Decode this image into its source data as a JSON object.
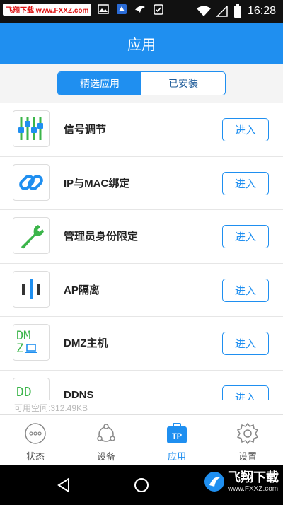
{
  "status_bar": {
    "watermark": "飞翔下载 www.FXXZ.com",
    "time": "16:28",
    "left_icons": [
      "image-icon",
      "app-icon",
      "bird-icon",
      "clipboard-check-icon"
    ],
    "right_icons": [
      "wifi-icon",
      "signal-icon",
      "battery-icon"
    ]
  },
  "header": {
    "title": "应用"
  },
  "tabs": [
    {
      "label": "精选应用",
      "active": true
    },
    {
      "label": "已安装",
      "active": false
    }
  ],
  "apps": [
    {
      "name": "信号调节",
      "button": "进入",
      "icon": "equalizer-icon"
    },
    {
      "name": "IP与MAC绑定",
      "button": "进入",
      "icon": "link-icon"
    },
    {
      "name": "管理员身份限定",
      "button": "进入",
      "icon": "wrench-icon"
    },
    {
      "name": "AP隔离",
      "button": "进入",
      "icon": "isolation-icon"
    },
    {
      "name": "DMZ主机",
      "button": "进入",
      "icon": "dmz-icon",
      "icon_text_1": "DM",
      "icon_text_2": "Z"
    },
    {
      "name": "DDNS",
      "button": "进入",
      "icon": "ddns-icon",
      "icon_text_1": "DD"
    }
  ],
  "free_space": "可用空间:312.49KB",
  "bottom_tabs": [
    {
      "label": "状态",
      "icon": "status-icon",
      "active": false
    },
    {
      "label": "设备",
      "icon": "devices-icon",
      "active": false
    },
    {
      "label": "应用",
      "icon": "tp-apps-icon",
      "active": true,
      "badge": "TP"
    },
    {
      "label": "设置",
      "icon": "gear-icon",
      "active": false
    }
  ],
  "watermark": {
    "brand": "飞翔下载",
    "url": "www.FXXZ.com"
  },
  "colors": {
    "accent": "#1f8ff0",
    "green": "#3bb54a",
    "header_bg": "#1f8ff0"
  }
}
